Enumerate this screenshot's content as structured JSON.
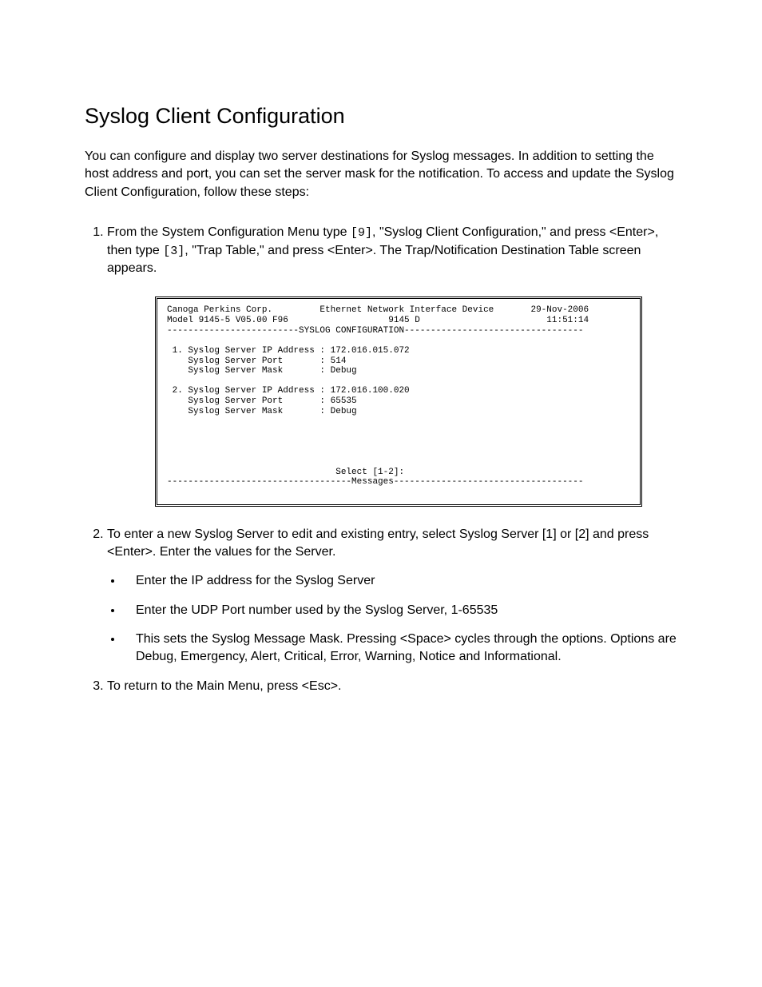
{
  "heading": "Syslog Client Configuration",
  "intro": "You can configure and display two server destinations for Syslog messages.  In addition to setting the host address and port, you can set the server mask for the notification.  To access and update the Syslog Client Configuration, follow these steps:",
  "step1_a": "From the System Configuration Menu type ",
  "step1_code1": "[9]",
  "step1_b": ", \"Syslog Client Configuration,\" and press <Enter>, then type ",
  "step1_code2": "[3]",
  "step1_c": ", \"Trap Table,\" and press <Enter>.  The Trap/Notification Destination Table screen appears.",
  "terminal": {
    "line1": "Canoga Perkins Corp.         Ethernet Network Interface Device       29-Nov-2006",
    "line2": "Model 9145-5 V05.00 F96                   9145 D                        11:51:14",
    "line3": "-------------------------SYSLOG CONFIGURATION----------------------------------",
    "line4": "",
    "line5": " 1. Syslog Server IP Address : 172.016.015.072",
    "line6": "    Syslog Server Port       : 514",
    "line7": "    Syslog Server Mask       : Debug",
    "line8": "",
    "line9": " 2. Syslog Server IP Address : 172.016.100.020",
    "line10": "    Syslog Server Port       : 65535",
    "line11": "    Syslog Server Mask       : Debug",
    "line12": "",
    "prompt": "                                Select [1-2]:",
    "msgline": "-----------------------------------Messages------------------------------------"
  },
  "step2": "To enter a new Syslog Server to edit and existing entry, select Syslog Server [1] or [2] and press <Enter>.  Enter the values for the Server.",
  "bullet1": "Enter the IP address for the Syslog Server",
  "bullet2": "Enter the UDP Port number used by the Syslog Server, 1-65535",
  "bullet3": "This sets the Syslog Message Mask.  Pressing <Space> cycles through the options.  Options are Debug, Emergency, Alert, Critical, Error, Warning, Notice and Informational.",
  "step3": "To return to the Main Menu, press <Esc>.",
  "chart_data": {
    "type": "table",
    "title": "SYSLOG CONFIGURATION",
    "header": {
      "company": "Canoga Perkins Corp.",
      "device": "Ethernet Network Interface Device",
      "date": "29-Nov-2006",
      "model": "Model 9145-5 V05.00 F96",
      "id": "9145 D",
      "time": "11:51:14"
    },
    "servers": [
      {
        "index": 1,
        "ip_address": "172.016.015.072",
        "port": 514,
        "mask": "Debug"
      },
      {
        "index": 2,
        "ip_address": "172.016.100.020",
        "port": 65535,
        "mask": "Debug"
      }
    ],
    "prompt": "Select [1-2]:",
    "footer_section": "Messages"
  }
}
